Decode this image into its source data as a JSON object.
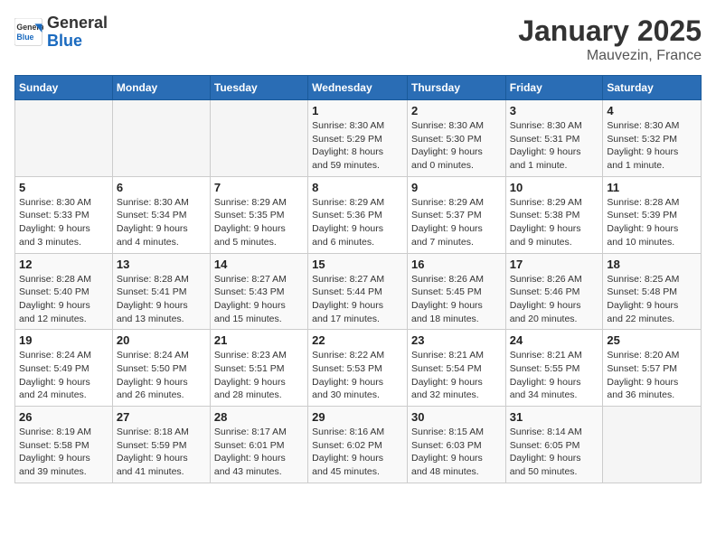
{
  "header": {
    "logo_general": "General",
    "logo_blue": "Blue",
    "month_title": "January 2025",
    "location": "Mauvezin, France"
  },
  "weekdays": [
    "Sunday",
    "Monday",
    "Tuesday",
    "Wednesday",
    "Thursday",
    "Friday",
    "Saturday"
  ],
  "weeks": [
    [
      {
        "day": "",
        "info": ""
      },
      {
        "day": "",
        "info": ""
      },
      {
        "day": "",
        "info": ""
      },
      {
        "day": "1",
        "info": "Sunrise: 8:30 AM\nSunset: 5:29 PM\nDaylight: 8 hours\nand 59 minutes."
      },
      {
        "day": "2",
        "info": "Sunrise: 8:30 AM\nSunset: 5:30 PM\nDaylight: 9 hours\nand 0 minutes."
      },
      {
        "day": "3",
        "info": "Sunrise: 8:30 AM\nSunset: 5:31 PM\nDaylight: 9 hours\nand 1 minute."
      },
      {
        "day": "4",
        "info": "Sunrise: 8:30 AM\nSunset: 5:32 PM\nDaylight: 9 hours\nand 1 minute."
      }
    ],
    [
      {
        "day": "5",
        "info": "Sunrise: 8:30 AM\nSunset: 5:33 PM\nDaylight: 9 hours\nand 3 minutes."
      },
      {
        "day": "6",
        "info": "Sunrise: 8:30 AM\nSunset: 5:34 PM\nDaylight: 9 hours\nand 4 minutes."
      },
      {
        "day": "7",
        "info": "Sunrise: 8:29 AM\nSunset: 5:35 PM\nDaylight: 9 hours\nand 5 minutes."
      },
      {
        "day": "8",
        "info": "Sunrise: 8:29 AM\nSunset: 5:36 PM\nDaylight: 9 hours\nand 6 minutes."
      },
      {
        "day": "9",
        "info": "Sunrise: 8:29 AM\nSunset: 5:37 PM\nDaylight: 9 hours\nand 7 minutes."
      },
      {
        "day": "10",
        "info": "Sunrise: 8:29 AM\nSunset: 5:38 PM\nDaylight: 9 hours\nand 9 minutes."
      },
      {
        "day": "11",
        "info": "Sunrise: 8:28 AM\nSunset: 5:39 PM\nDaylight: 9 hours\nand 10 minutes."
      }
    ],
    [
      {
        "day": "12",
        "info": "Sunrise: 8:28 AM\nSunset: 5:40 PM\nDaylight: 9 hours\nand 12 minutes."
      },
      {
        "day": "13",
        "info": "Sunrise: 8:28 AM\nSunset: 5:41 PM\nDaylight: 9 hours\nand 13 minutes."
      },
      {
        "day": "14",
        "info": "Sunrise: 8:27 AM\nSunset: 5:43 PM\nDaylight: 9 hours\nand 15 minutes."
      },
      {
        "day": "15",
        "info": "Sunrise: 8:27 AM\nSunset: 5:44 PM\nDaylight: 9 hours\nand 17 minutes."
      },
      {
        "day": "16",
        "info": "Sunrise: 8:26 AM\nSunset: 5:45 PM\nDaylight: 9 hours\nand 18 minutes."
      },
      {
        "day": "17",
        "info": "Sunrise: 8:26 AM\nSunset: 5:46 PM\nDaylight: 9 hours\nand 20 minutes."
      },
      {
        "day": "18",
        "info": "Sunrise: 8:25 AM\nSunset: 5:48 PM\nDaylight: 9 hours\nand 22 minutes."
      }
    ],
    [
      {
        "day": "19",
        "info": "Sunrise: 8:24 AM\nSunset: 5:49 PM\nDaylight: 9 hours\nand 24 minutes."
      },
      {
        "day": "20",
        "info": "Sunrise: 8:24 AM\nSunset: 5:50 PM\nDaylight: 9 hours\nand 26 minutes."
      },
      {
        "day": "21",
        "info": "Sunrise: 8:23 AM\nSunset: 5:51 PM\nDaylight: 9 hours\nand 28 minutes."
      },
      {
        "day": "22",
        "info": "Sunrise: 8:22 AM\nSunset: 5:53 PM\nDaylight: 9 hours\nand 30 minutes."
      },
      {
        "day": "23",
        "info": "Sunrise: 8:21 AM\nSunset: 5:54 PM\nDaylight: 9 hours\nand 32 minutes."
      },
      {
        "day": "24",
        "info": "Sunrise: 8:21 AM\nSunset: 5:55 PM\nDaylight: 9 hours\nand 34 minutes."
      },
      {
        "day": "25",
        "info": "Sunrise: 8:20 AM\nSunset: 5:57 PM\nDaylight: 9 hours\nand 36 minutes."
      }
    ],
    [
      {
        "day": "26",
        "info": "Sunrise: 8:19 AM\nSunset: 5:58 PM\nDaylight: 9 hours\nand 39 minutes."
      },
      {
        "day": "27",
        "info": "Sunrise: 8:18 AM\nSunset: 5:59 PM\nDaylight: 9 hours\nand 41 minutes."
      },
      {
        "day": "28",
        "info": "Sunrise: 8:17 AM\nSunset: 6:01 PM\nDaylight: 9 hours\nand 43 minutes."
      },
      {
        "day": "29",
        "info": "Sunrise: 8:16 AM\nSunset: 6:02 PM\nDaylight: 9 hours\nand 45 minutes."
      },
      {
        "day": "30",
        "info": "Sunrise: 8:15 AM\nSunset: 6:03 PM\nDaylight: 9 hours\nand 48 minutes."
      },
      {
        "day": "31",
        "info": "Sunrise: 8:14 AM\nSunset: 6:05 PM\nDaylight: 9 hours\nand 50 minutes."
      },
      {
        "day": "",
        "info": ""
      }
    ]
  ]
}
